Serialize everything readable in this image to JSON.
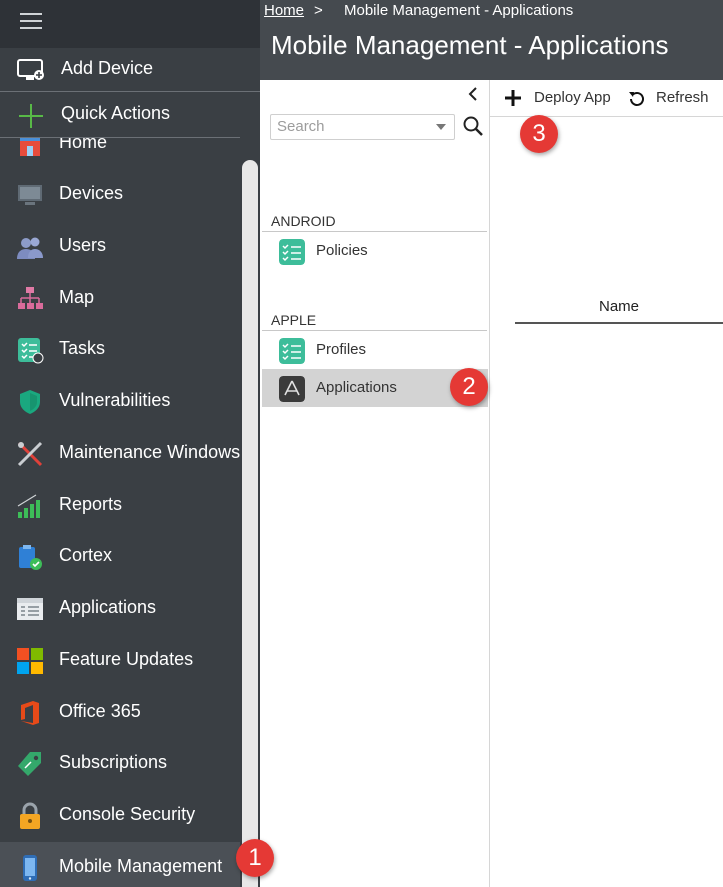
{
  "sidebar": {
    "menu_icon": "hamburger-icon",
    "add_device": {
      "label": "Add Device",
      "icon": "monitor-add-icon"
    },
    "quick_actions": {
      "label": "Quick Actions",
      "icon": "plus-icon"
    },
    "items": [
      {
        "label": "Home",
        "icon": "home-icon"
      },
      {
        "label": "Devices",
        "icon": "monitor-icon"
      },
      {
        "label": "Users",
        "icon": "users-icon"
      },
      {
        "label": "Map",
        "icon": "network-map-icon"
      },
      {
        "label": "Tasks",
        "icon": "tasks-icon"
      },
      {
        "label": "Vulnerabilities",
        "icon": "shield-icon"
      },
      {
        "label": "Maintenance Windows",
        "icon": "tools-icon"
      },
      {
        "label": "Reports",
        "icon": "bar-chart-icon"
      },
      {
        "label": "Cortex",
        "icon": "clipboard-check-icon"
      },
      {
        "label": "Applications",
        "icon": "app-list-icon"
      },
      {
        "label": "Feature Updates",
        "icon": "windows-icon"
      },
      {
        "label": "Office 365",
        "icon": "office-icon"
      },
      {
        "label": "Subscriptions",
        "icon": "tag-icon"
      },
      {
        "label": "Console Security",
        "icon": "lock-icon"
      },
      {
        "label": "Mobile Management",
        "icon": "phone-icon"
      }
    ]
  },
  "breadcrumb": {
    "home": "Home",
    "separator": ">",
    "current": "Mobile Management - Applications"
  },
  "header": {
    "title": "Mobile Management - Applications"
  },
  "middle_panel": {
    "collapse_icon": "chevron-left-icon",
    "search": {
      "placeholder": "Search"
    },
    "sections": [
      {
        "title": "ANDROID",
        "items": [
          {
            "label": "Policies",
            "icon": "checklist-icon"
          }
        ]
      },
      {
        "title": "APPLE",
        "items": [
          {
            "label": "Profiles",
            "icon": "checklist-icon"
          },
          {
            "label": "Applications",
            "icon": "app-store-icon"
          }
        ]
      }
    ]
  },
  "toolbar": {
    "deploy": "Deploy App",
    "refresh": "Refresh"
  },
  "table": {
    "columns": [
      "Name"
    ]
  },
  "badges": [
    "1",
    "2",
    "3"
  ],
  "colors": {
    "sidebar": "#3a3f44",
    "header": "#454a4f",
    "badge": "#e53935",
    "accent_green": "#3dbd9a"
  }
}
